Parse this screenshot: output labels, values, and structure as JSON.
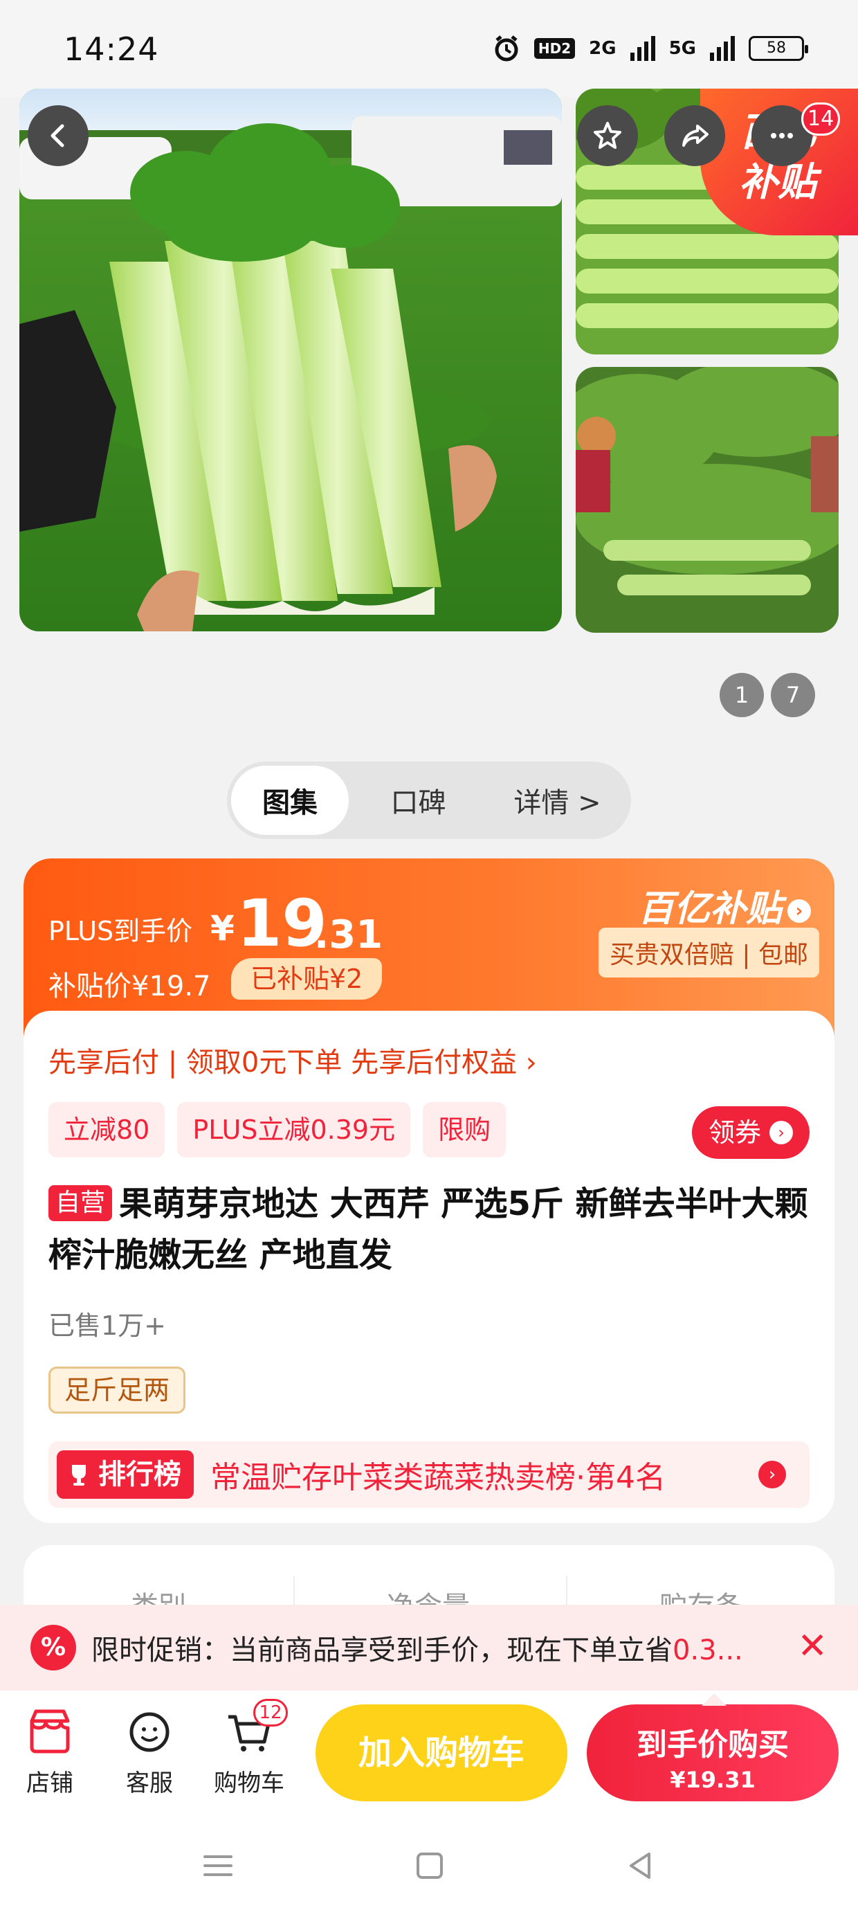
{
  "status_bar": {
    "time": "14:24",
    "hd_label": "HD2",
    "net1": "2G",
    "net2": "5G",
    "battery": "58"
  },
  "top_nav": {
    "back_icon": "chevron-left-icon",
    "favorite_icon": "star-icon",
    "share_icon": "share-icon",
    "more_icon": "more-icon",
    "more_badge": "14"
  },
  "gallery": {
    "subsidy_tag_line1": "百亿",
    "subsidy_tag_line2": "补贴",
    "counter_current": "1",
    "counter_total": "7"
  },
  "tabs": [
    {
      "label": "图集",
      "active": true
    },
    {
      "label": "口碑",
      "active": false
    },
    {
      "label": "详情 >",
      "active": false
    }
  ],
  "price": {
    "plus_label": "PLUS到手价",
    "yen": "¥",
    "integer": "19",
    "decimal": ".31",
    "subsidy_price": "补贴价¥19.7",
    "subsidy_chip": "已补贴¥2",
    "logo_text": "百亿补贴",
    "guarantee": "买贵双倍赔 | 包邮"
  },
  "offers": {
    "pay_later": "先享后付 | 领取0元下单 先享后付权益 ›",
    "promos": [
      "立减80",
      "PLUS立减0.39元",
      "限购"
    ],
    "coupon_button": "领券"
  },
  "product": {
    "self_operated_tag": "自营",
    "title": "果萌芽京地达 大西芹 严选5斤 新鲜去半叶大颗 榨汁脆嫩无丝 产地直发",
    "sold": "已售1万+",
    "weight_tag": "足斤足两",
    "rank_label": "排行榜",
    "rank_text": "常温贮存叶菜类蔬菜热卖榜·第4名"
  },
  "spec": {
    "col1": "类别",
    "col2": "净含量",
    "col3": "贮存条"
  },
  "promo_strip": {
    "icon_text": "%",
    "text_prefix": "限时促销：当前商品享受到手价，现在下单立省",
    "text_highlight": "0.3...",
    "close_icon": "close-icon"
  },
  "bottom_bar": {
    "store_label": "店铺",
    "service_label": "客服",
    "cart_label": "购物车",
    "cart_count": "12",
    "add_to_cart": "加入购物车",
    "buy_now_line1": "到手价购买",
    "buy_now_line2": "¥19.31"
  },
  "colors": {
    "accent_red": "#f0233b",
    "accent_orange": "#ff5a12",
    "add_cart_yellow": "#ffd21a"
  }
}
